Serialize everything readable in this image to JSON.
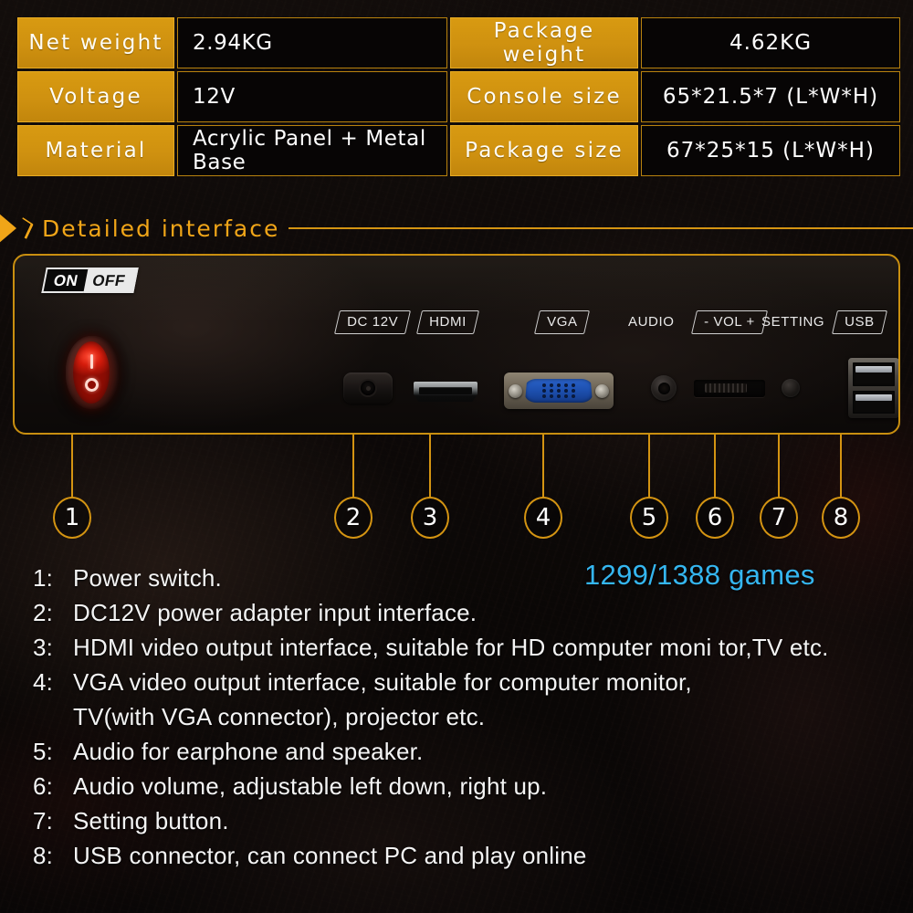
{
  "spec_table": {
    "rows": [
      {
        "label_left": "Net weight",
        "value_left": "2.94KG",
        "label_right": "Package weight",
        "value_right": "4.62KG"
      },
      {
        "label_left": "Voltage",
        "value_left": "12V",
        "label_right": "Console size",
        "value_right": "65*21.5*7 (L*W*H)"
      },
      {
        "label_left": "Material",
        "value_left": "Acrylic Panel + Metal Base",
        "label_right": "Package size",
        "value_right": "67*25*15 (L*W*H)"
      }
    ]
  },
  "section": {
    "title": "Detailed interface"
  },
  "panel": {
    "power_badge": {
      "on": "ON",
      "off": "OFF"
    },
    "port_labels": [
      {
        "text": "DC 12V",
        "boxed": true
      },
      {
        "text": "HDMI",
        "boxed": true
      },
      {
        "text": "VGA",
        "boxed": true
      },
      {
        "text": "AUDIO",
        "boxed": false
      },
      {
        "text": "- VOL +",
        "boxed": true
      },
      {
        "text": "SETTING",
        "boxed": false
      },
      {
        "text": "USB",
        "boxed": true
      }
    ]
  },
  "callouts": {
    "numbers": [
      "1",
      "2",
      "3",
      "4",
      "5",
      "6",
      "7",
      "8"
    ]
  },
  "legend": {
    "items": [
      {
        "num": "1:",
        "text": "Power switch."
      },
      {
        "num": "2:",
        "text": "DC12V power adapter input interface."
      },
      {
        "num": "3:",
        "text": "HDMI video output interface, suitable for HD computer moni tor,TV etc."
      },
      {
        "num": "4:",
        "text": "VGA video output interface, suitable for computer monitor,",
        "continuation": "TV(with VGA connector), projector etc."
      },
      {
        "num": "5:",
        "text": "Audio for earphone and speaker."
      },
      {
        "num": "6:",
        "text": "Audio volume, adjustable left down, right up."
      },
      {
        "num": "7:",
        "text": "Setting button."
      },
      {
        "num": "8:",
        "text": "USB connector, can connect PC and play online"
      }
    ]
  },
  "games_badge": {
    "text": "1299/1388 games",
    "color": "#35b6f0"
  },
  "colors": {
    "accent_orange": "#d49412",
    "label_gold": "#cf9110",
    "cyan": "#35b6f0",
    "background": "#0a0706"
  }
}
